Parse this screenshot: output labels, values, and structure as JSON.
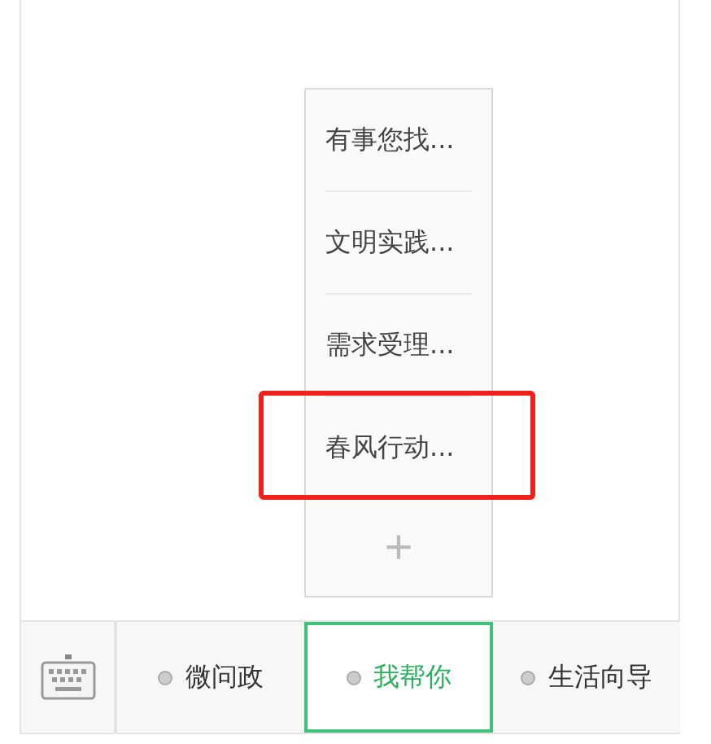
{
  "submenu": [
    {
      "label": "有事您找...",
      "highlighted": false
    },
    {
      "label": "文明实践...",
      "highlighted": false
    },
    {
      "label": "需求受理...",
      "highlighted": false
    },
    {
      "label": "春风行动...",
      "highlighted": true
    }
  ],
  "add_button": "+",
  "menu": [
    {
      "label": "微问政",
      "selected": false
    },
    {
      "label": "我帮你",
      "selected": true
    },
    {
      "label": "生活向导",
      "selected": false
    }
  ]
}
